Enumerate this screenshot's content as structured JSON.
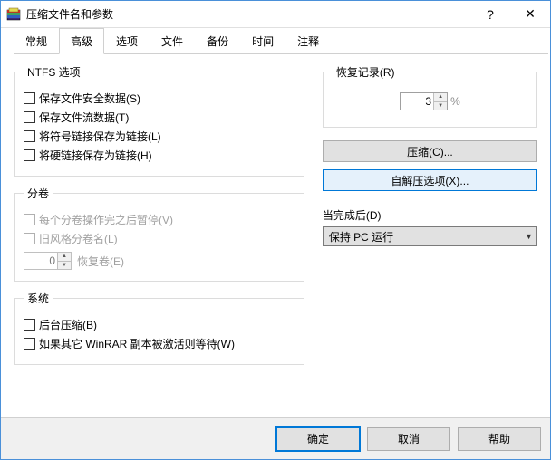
{
  "titlebar": {
    "title": "压缩文件名和参数",
    "help_symbol": "?",
    "close_symbol": "✕"
  },
  "tabs": [
    {
      "label": "常规",
      "active": false
    },
    {
      "label": "高级",
      "active": true
    },
    {
      "label": "选项",
      "active": false
    },
    {
      "label": "文件",
      "active": false
    },
    {
      "label": "备份",
      "active": false
    },
    {
      "label": "时间",
      "active": false
    },
    {
      "label": "注释",
      "active": false
    }
  ],
  "ntfs": {
    "legend": "NTFS 选项",
    "items": [
      {
        "label": "保存文件安全数据(S)",
        "checked": false
      },
      {
        "label": "保存文件流数据(T)",
        "checked": false
      },
      {
        "label": "将符号链接保存为链接(L)",
        "checked": false
      },
      {
        "label": "将硬链接保存为链接(H)",
        "checked": false
      }
    ]
  },
  "volumes": {
    "legend": "分卷",
    "items": [
      {
        "label": "每个分卷操作完之后暂停(V)",
        "checked": false,
        "disabled": true
      },
      {
        "label": "旧风格分卷名(L)",
        "checked": false,
        "disabled": true
      }
    ],
    "recovery_value": "0",
    "recovery_label": "恢复卷(E)"
  },
  "system": {
    "legend": "系统",
    "items": [
      {
        "label": "后台压缩(B)",
        "checked": false
      },
      {
        "label": "如果其它 WinRAR 副本被激活则等待(W)",
        "checked": false
      }
    ]
  },
  "recovery": {
    "legend": "恢复记录(R)",
    "value": "3",
    "pct": "%"
  },
  "buttons": {
    "compress": "压缩(C)...",
    "sfx": "自解压选项(X)..."
  },
  "when_done": {
    "label": "当完成后(D)",
    "value": "保持 PC 运行"
  },
  "footer": {
    "ok": "确定",
    "cancel": "取消",
    "help": "帮助"
  }
}
